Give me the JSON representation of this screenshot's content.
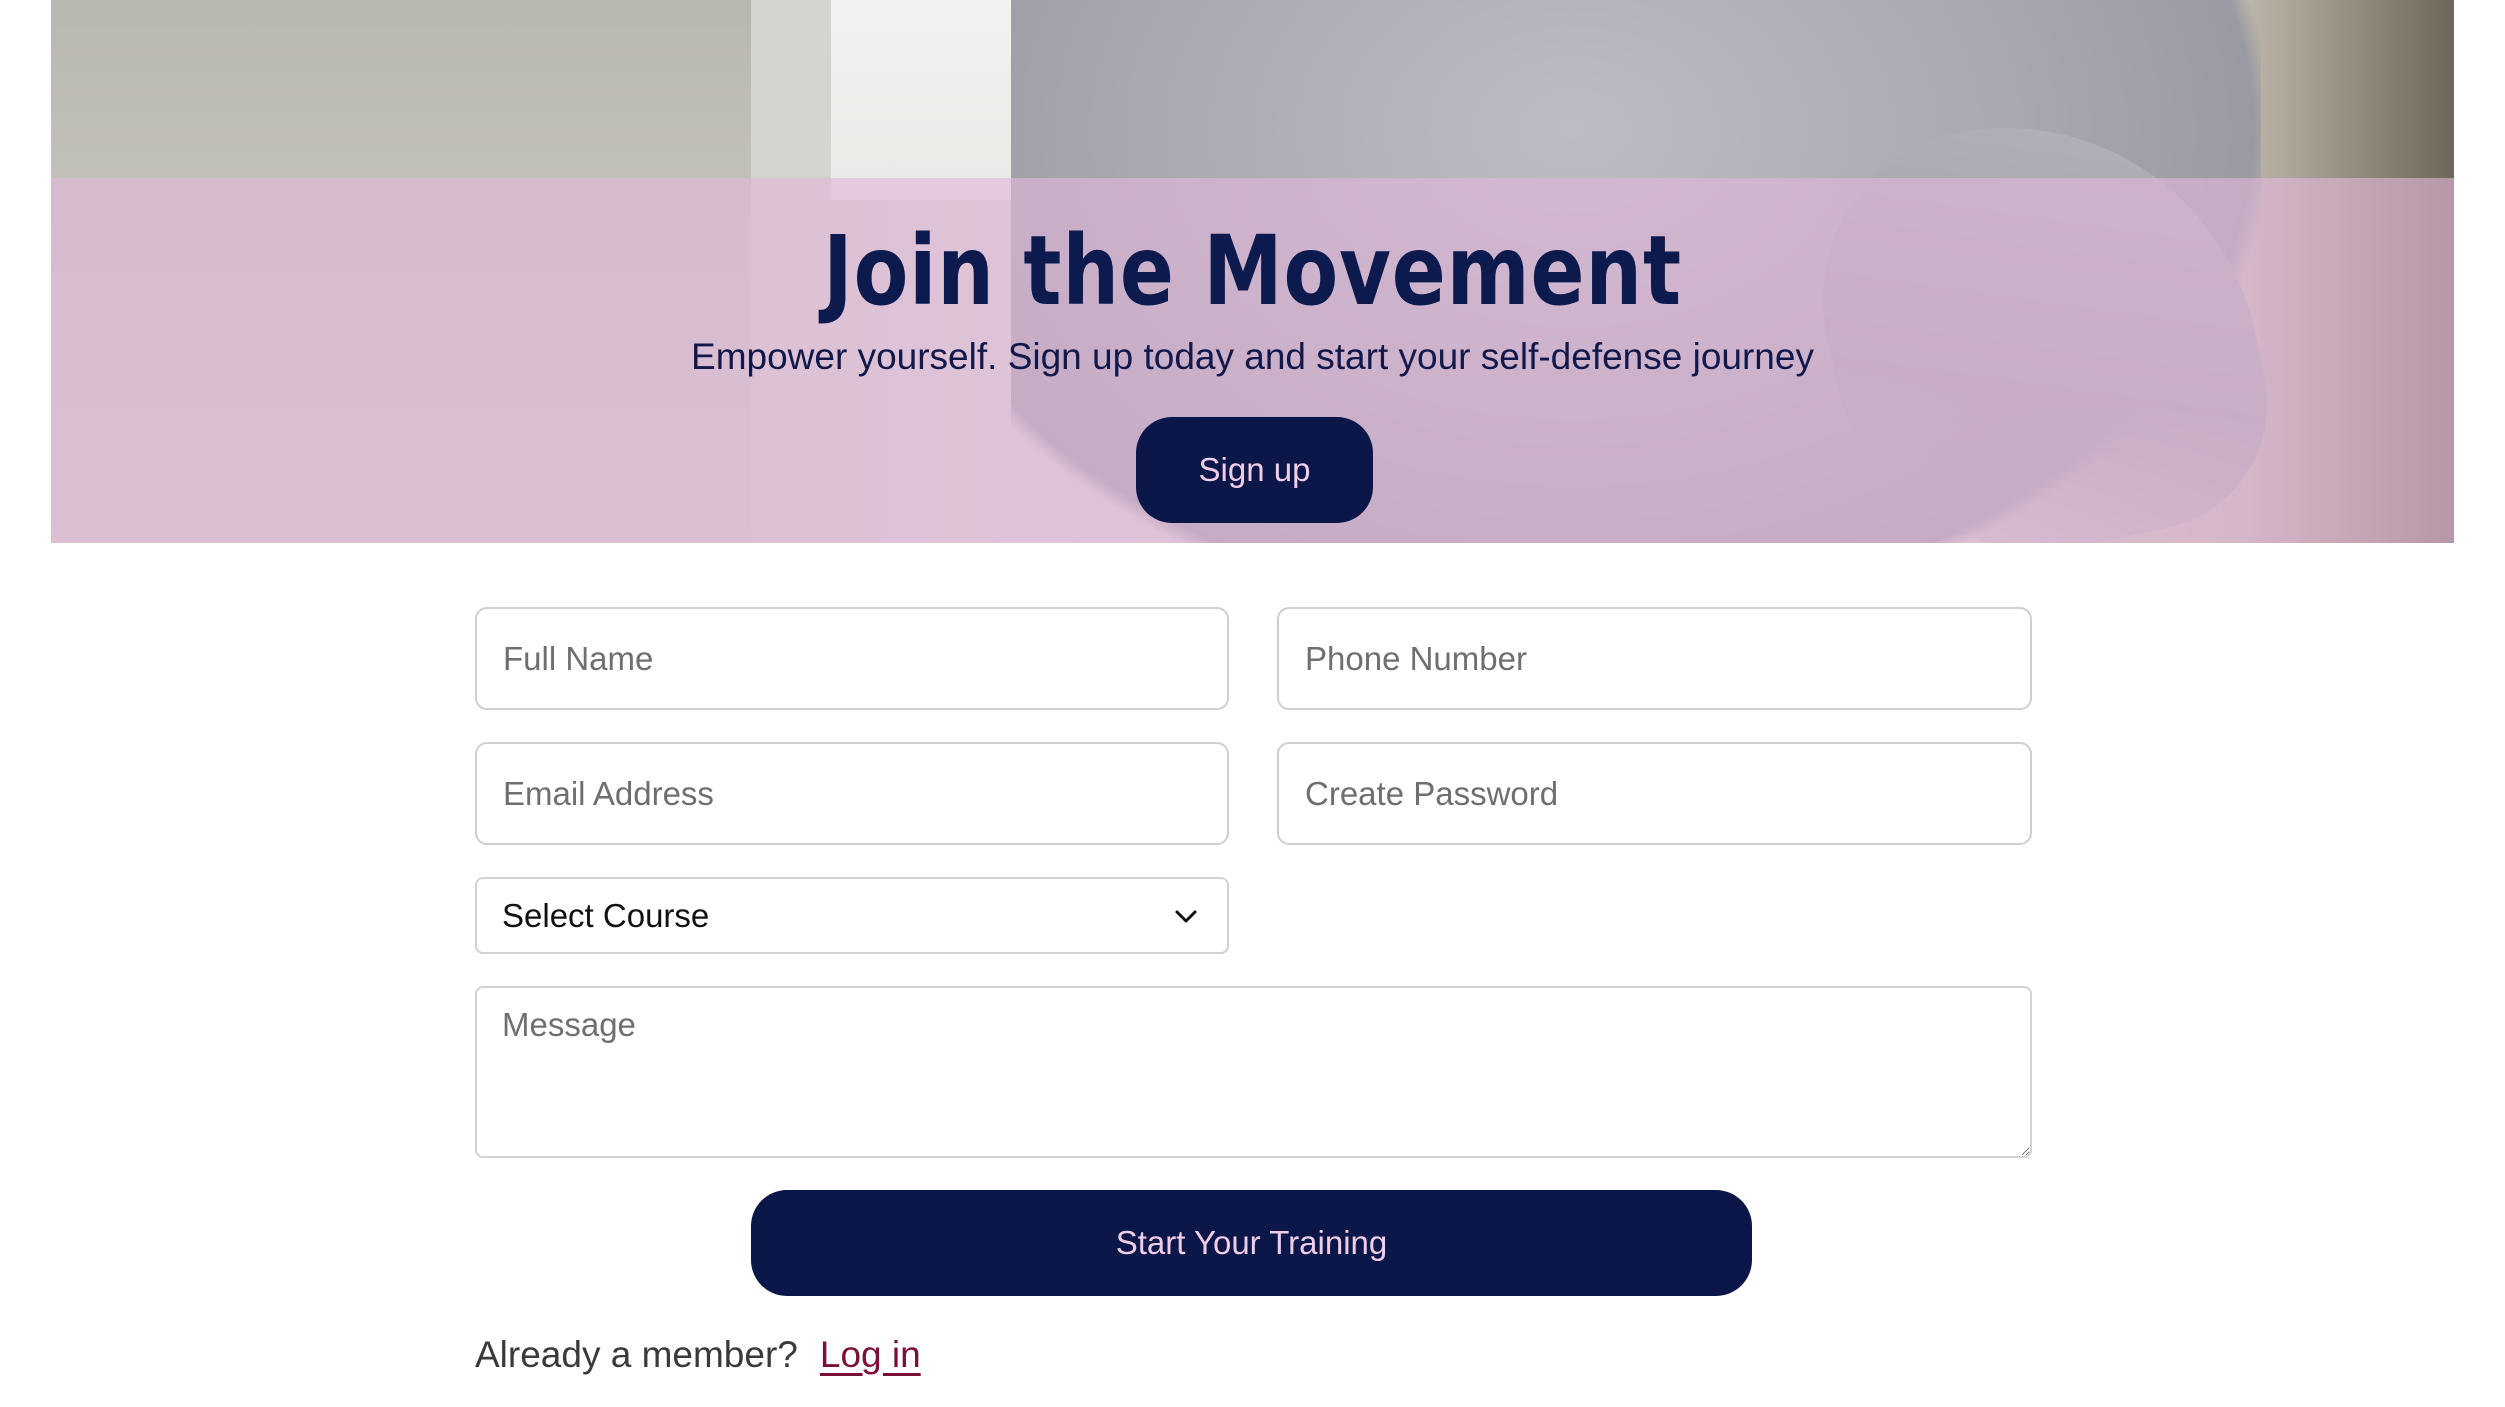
{
  "hero": {
    "title": "Join the Movement",
    "subtitle": "Empower yourself. Sign up today and start your self-defense journey",
    "signup_label": "Sign up",
    "band_color": "#e2b6da",
    "accent_color": "#0b1649"
  },
  "form": {
    "full_name": {
      "placeholder": "Full Name",
      "value": ""
    },
    "phone": {
      "placeholder": "Phone Number",
      "value": ""
    },
    "email": {
      "placeholder": "Email Address",
      "value": ""
    },
    "password": {
      "placeholder": "Create Password",
      "value": ""
    },
    "course": {
      "selected": "Select Course",
      "icon": "chevron-down-icon"
    },
    "message": {
      "placeholder": "Message",
      "value": ""
    },
    "submit_label": "Start Your Training"
  },
  "footer": {
    "member_prompt": "Already a member?",
    "login_label": "Log in",
    "link_color": "#7a1038"
  }
}
